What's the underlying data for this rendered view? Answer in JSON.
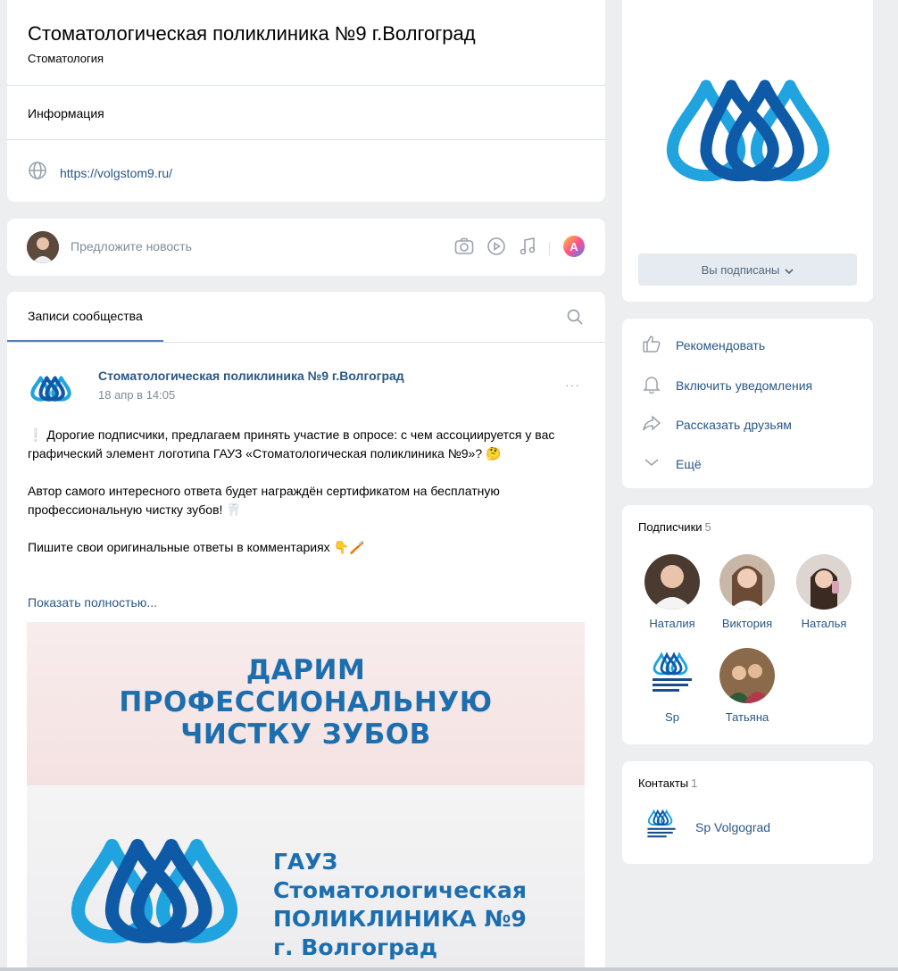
{
  "header": {
    "title": "Стоматологическая поликлиника №9 г.Волгоград",
    "subtitle": "Стоматология",
    "info_label": "Информация",
    "website": "https://volgstom9.ru/"
  },
  "suggest": {
    "placeholder": "Предложите новость",
    "icons": [
      "photo-icon",
      "video-icon",
      "music-icon",
      "poster-icon"
    ]
  },
  "wall": {
    "tab_label": "Записи сообщества",
    "post": {
      "author": "Стоматологическая поликлиника №9 г.Волгоград",
      "date": "18 апр в 14:05",
      "more": "···",
      "lines": [
        "❕ Дорогие подписчики, предлагаем принять участие в опросе: с чем ассоциируется у вас графический элемент логотипа ГАУЗ «Стоматологическая поликлиника №9»? 🤔",
        "",
        "Автор самого интересного ответа будет награждён сертификатом на бесплатную профессиональную чистку зубов! 🦷",
        "",
        "Пишите свои оригинальные ответы в комментариях 👇🪥"
      ],
      "show_more": "Показать полностью...",
      "image": {
        "headline": [
          "ДАРИМ",
          "ПРОФЕССИОНАЛЬНУЮ",
          "ЧИСТКУ ЗУБОВ"
        ],
        "org": [
          "ГАУЗ",
          "Стоматологическая",
          "ПОЛИКЛИНИКА №9",
          "г. Волгоград"
        ]
      }
    }
  },
  "sidebar": {
    "subscribe_label": "Вы подписаны",
    "actions": [
      {
        "label": "Рекомендовать",
        "icon": "thumbs-up-icon"
      },
      {
        "label": "Включить уведомления",
        "icon": "bell-icon"
      },
      {
        "label": "Рассказать друзьям",
        "icon": "share-icon"
      },
      {
        "label": "Ещё",
        "icon": "chevron-down-icon"
      }
    ],
    "subscribers": {
      "title": "Подписчики",
      "count": "5",
      "members": [
        {
          "name": "Наталия"
        },
        {
          "name": "Виктория"
        },
        {
          "name": "Наталья"
        },
        {
          "name": "Sp"
        },
        {
          "name": "Татьяна"
        }
      ]
    },
    "contacts": {
      "title": "Контакты",
      "count": "1",
      "name": "Sp Volgograd"
    }
  },
  "colors": {
    "link": "#2a5885",
    "logo_light": "#20a3df",
    "logo_dark": "#0f5aa6",
    "background": "#edeef0"
  }
}
